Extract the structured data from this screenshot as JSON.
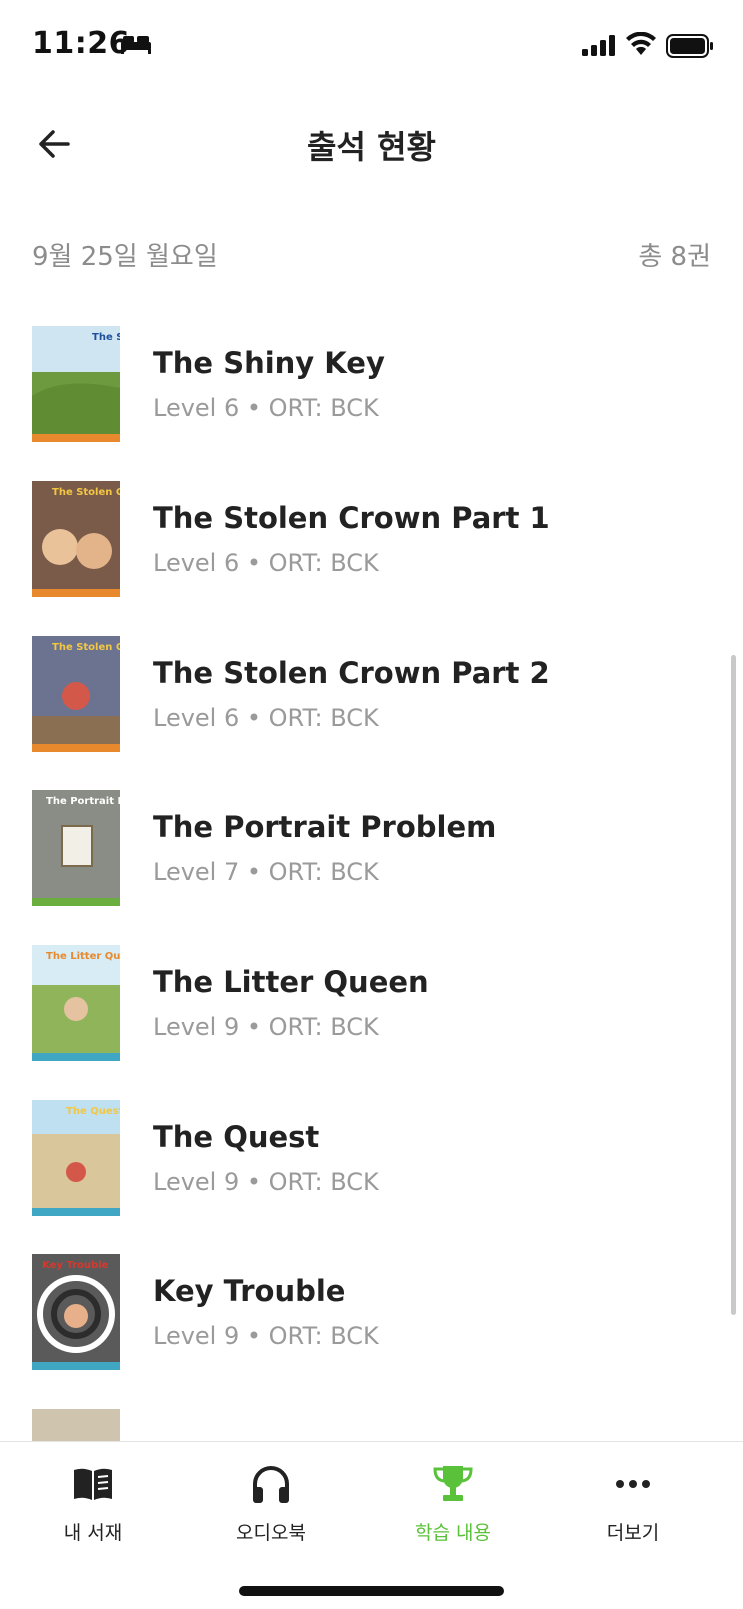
{
  "status_bar": {
    "time": "11:26"
  },
  "header": {
    "title": "출석 현황"
  },
  "summary": {
    "date": "9월 25일 월요일",
    "total": "총 8권"
  },
  "books": [
    {
      "title": "The Shiny Key",
      "meta": "Level 6 • ORT: BCK",
      "cover_text": "The Shiny Key",
      "cover_color": "#6d9a3e"
    },
    {
      "title": "The Stolen Crown Part 1",
      "meta": "Level 6 • ORT: BCK",
      "cover_text": "The Stolen Crown",
      "cover_color": "#7a5b4a"
    },
    {
      "title": "The Stolen Crown Part 2",
      "meta": "Level 6 • ORT: BCK",
      "cover_text": "The Stolen Crown",
      "cover_color": "#6b7390"
    },
    {
      "title": "The Portrait Problem",
      "meta": "Level 7 • ORT: BCK",
      "cover_text": "The Portrait Problem",
      "cover_color": "#8a8d86"
    },
    {
      "title": "The Litter Queen",
      "meta": "Level 9 • ORT: BCK",
      "cover_text": "The Litter Queen",
      "cover_color": "#8fb45a"
    },
    {
      "title": "The Quest",
      "meta": "Level 9 • ORT: BCK",
      "cover_text": "The Quest",
      "cover_color": "#d9c69a"
    },
    {
      "title": "Key Trouble",
      "meta": "Level 9 • ORT: BCK",
      "cover_text": "Key Trouble",
      "cover_color": "#5a5a5a"
    }
  ],
  "tab_bar": {
    "active_color": "#59c23a",
    "tabs": [
      {
        "label": "내 서재",
        "icon": "book-icon"
      },
      {
        "label": "오디오북",
        "icon": "headphones-icon"
      },
      {
        "label": "학습 내용",
        "icon": "trophy-icon",
        "active": true
      },
      {
        "label": "더보기",
        "icon": "more-icon"
      }
    ]
  }
}
